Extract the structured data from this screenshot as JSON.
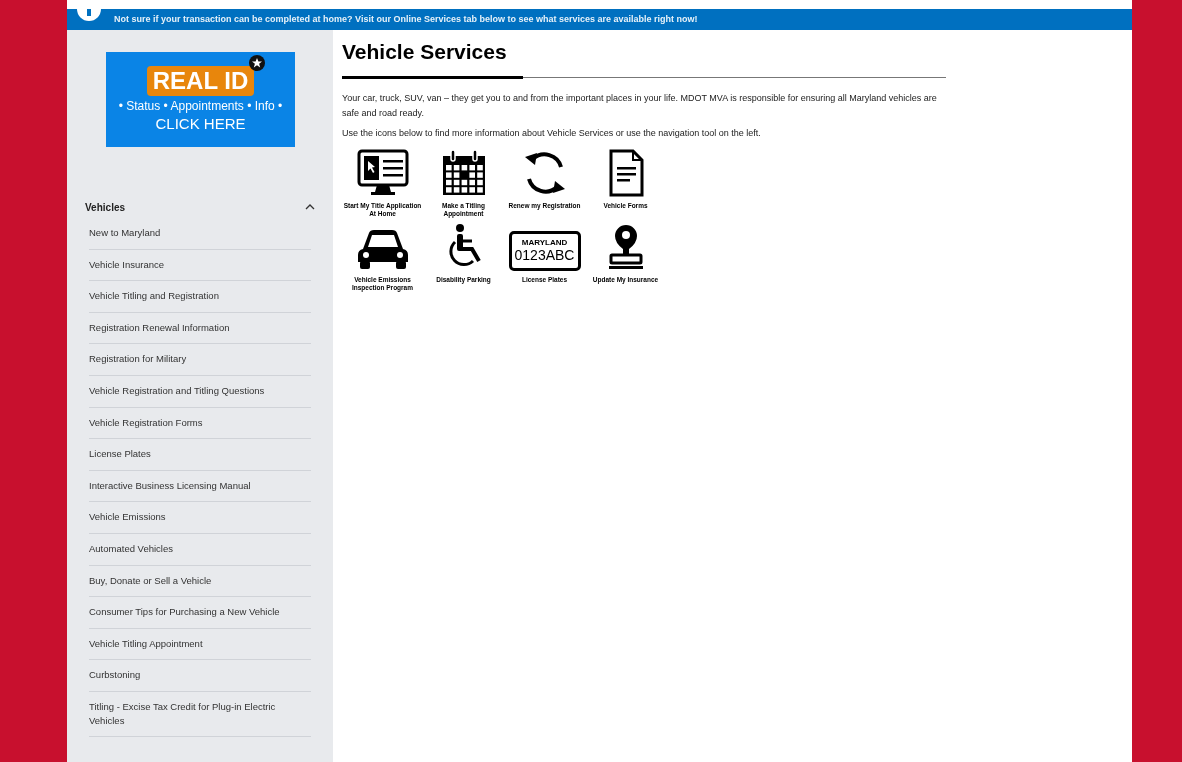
{
  "banner": {
    "text": "Not sure if your transaction can be completed at home? Visit our Online Services tab below to see what services are available right now!"
  },
  "real_id_ad": {
    "title": "REAL ID",
    "subtitle": "• Status • Appointments • Info •",
    "cta": "CLICK HERE"
  },
  "sidebar": {
    "heading": "Vehicles",
    "expanded": true,
    "items": [
      {
        "label": "New to Maryland"
      },
      {
        "label": "Vehicle Insurance"
      },
      {
        "label": "Vehicle Titling and Registration"
      },
      {
        "label": "Registration Renewal Information"
      },
      {
        "label": "Registration for Military"
      },
      {
        "label": "Vehicle Registration and Titling Questions"
      },
      {
        "label": "Vehicle Registration Forms"
      },
      {
        "label": "License Plates"
      },
      {
        "label": "Interactive Business Licensing Manual"
      },
      {
        "label": "Vehicle Emissions"
      },
      {
        "label": "Automated Vehicles"
      },
      {
        "label": "Buy, Donate or Sell a Vehicle"
      },
      {
        "label": "Consumer Tips for Purchasing a New Vehicle"
      },
      {
        "label": "Vehicle Titling Appointment"
      },
      {
        "label": "Curbstoning"
      },
      {
        "label": "Titling - Excise Tax Credit for Plug-in Electric Vehicles"
      }
    ]
  },
  "main": {
    "title": "Vehicle Services",
    "paragraphs": [
      "Your car, truck, SUV, van – they get you to and from the important places in your life. MDOT MVA is responsible for ensuring all Maryland vehicles are safe and road ready.",
      "Use the icons below to find more information about Vehicle Services or use the navigation tool on the left."
    ],
    "services": [
      {
        "kind": "monitor",
        "label": "Start My Title Application At Home"
      },
      {
        "kind": "calendar",
        "label": "Make a Titling Appointment"
      },
      {
        "kind": "renew",
        "label": "Renew my Registration"
      },
      {
        "kind": "document",
        "label": "Vehicle Forms"
      },
      {
        "kind": "car",
        "label": "Vehicle Emissions Inspection Program"
      },
      {
        "kind": "wheelchair",
        "label": "Disability Parking"
      },
      {
        "kind": "plate",
        "label": "License Plates",
        "plate_state": "MARYLAND",
        "plate_number": "0123ABC"
      },
      {
        "kind": "stamp",
        "label": "Update My Insurance"
      }
    ]
  }
}
